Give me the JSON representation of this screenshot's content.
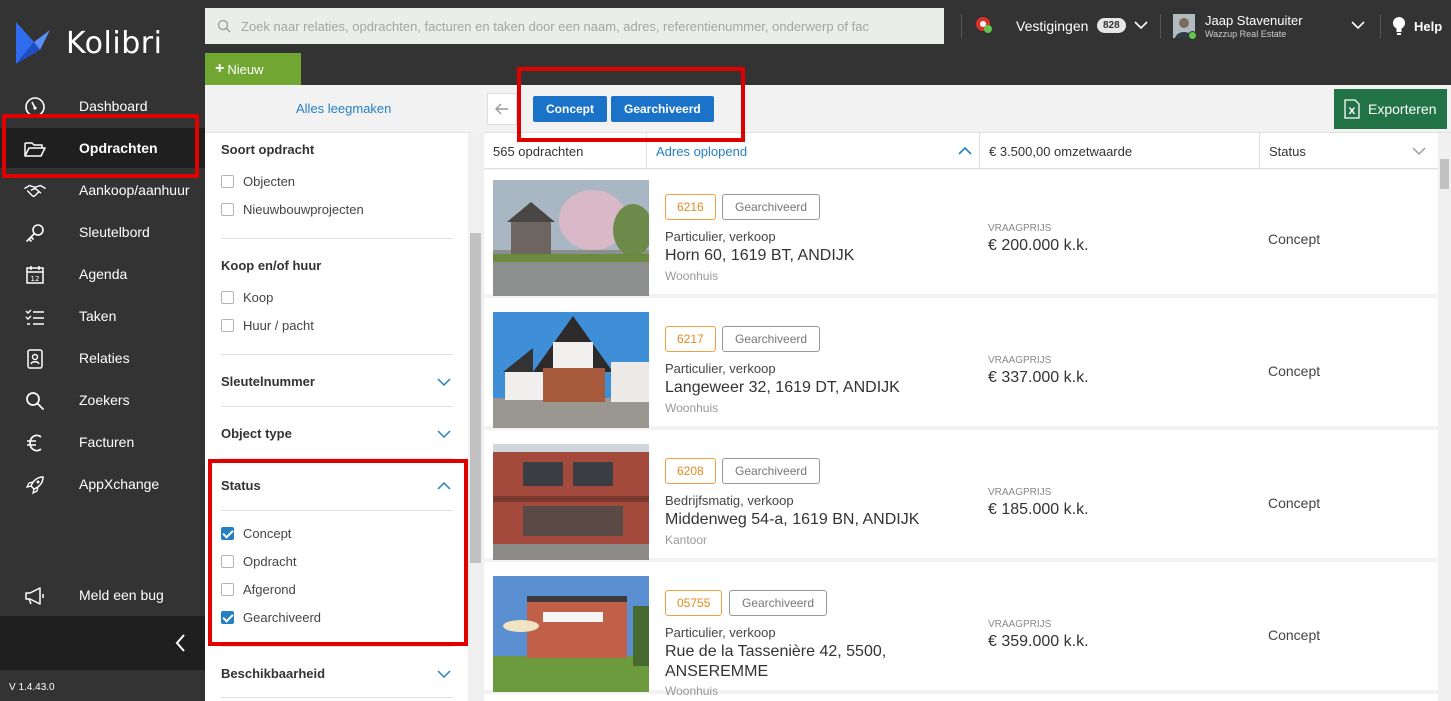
{
  "app": {
    "name": "Kolibri",
    "version": "V 1.4.43.0"
  },
  "search": {
    "placeholder": "Zoek naar relaties, opdrachten, facturen en taken door een naam, adres, referentienummer, onderwerp of fac"
  },
  "topbar": {
    "vestigingen_label": "Vestigingen",
    "vestigingen_count": "828",
    "user_name": "Jaap Stavenuiter",
    "user_company": "Wazzup Real Estate",
    "help_label": "Help",
    "new_button": "Nieuw"
  },
  "sidebar": {
    "items": [
      {
        "label": "Dashboard",
        "icon": "gauge-icon"
      },
      {
        "label": "Opdrachten",
        "icon": "folder-open-icon",
        "active": true
      },
      {
        "label": "Aankoop/aanhuur",
        "icon": "handshake-icon"
      },
      {
        "label": "Sleutelbord",
        "icon": "key-icon"
      },
      {
        "label": "Agenda",
        "icon": "calendar-icon"
      },
      {
        "label": "Taken",
        "icon": "tasks-icon"
      },
      {
        "label": "Relaties",
        "icon": "contact-icon"
      },
      {
        "label": "Zoekers",
        "icon": "search-icon"
      },
      {
        "label": "Facturen",
        "icon": "euro-icon"
      },
      {
        "label": "AppXchange",
        "icon": "rocket-icon"
      }
    ],
    "bug_label": "Meld een bug"
  },
  "filters": {
    "clear_all": "Alles leegmaken",
    "soort": {
      "title": "Soort opdracht",
      "options": [
        "Objecten",
        "Nieuwbouwprojecten"
      ]
    },
    "koop": {
      "title": "Koop en/of huur",
      "options": [
        "Koop",
        "Huur / pacht"
      ]
    },
    "sleutelnummer": {
      "title": "Sleutelnummer"
    },
    "objecttype": {
      "title": "Object type"
    },
    "status": {
      "title": "Status",
      "options": [
        {
          "label": "Concept",
          "checked": true
        },
        {
          "label": "Opdracht",
          "checked": false
        },
        {
          "label": "Afgerond",
          "checked": false
        },
        {
          "label": "Gearchiveerd",
          "checked": true
        }
      ]
    },
    "beschikbaarheid": {
      "title": "Beschikbaarheid"
    }
  },
  "toolbar": {
    "active_filters": [
      "Concept",
      "Gearchiveerd"
    ],
    "export_label": "Exporteren"
  },
  "columns": {
    "count": "565 opdrachten",
    "address": "Adres oplopend",
    "value": "€ 3.500,00 omzetwaarde",
    "status": "Status"
  },
  "rows": [
    {
      "code": "6216",
      "badge": "Gearchiveerd",
      "type": "Particulier, verkoop",
      "address": "Horn 60, 1619 BT, ANDIJK",
      "kind": "Woonhuis",
      "price_label": "VRAAGPRIJS",
      "price": "€ 200.000 k.k.",
      "status": "Concept"
    },
    {
      "code": "6217",
      "badge": "Gearchiveerd",
      "type": "Particulier, verkoop",
      "address": "Langeweer 32, 1619 DT, ANDIJK",
      "kind": "Woonhuis",
      "price_label": "VRAAGPRIJS",
      "price": "€ 337.000 k.k.",
      "status": "Concept"
    },
    {
      "code": "6208",
      "badge": "Gearchiveerd",
      "type": "Bedrijfsmatig, verkoop",
      "address": "Middenweg 54-a, 1619 BN, ANDIJK",
      "kind": "Kantoor",
      "price_label": "VRAAGPRIJS",
      "price": "€ 185.000 k.k.",
      "status": "Concept"
    },
    {
      "code": "05755",
      "badge": "Gearchiveerd",
      "type": "Particulier, verkoop",
      "address": "Rue de la Tassenière 42, 5500, ANSEREMME",
      "kind": "Woonhuis",
      "price_label": "VRAAGPRIJS",
      "price": "€ 359.000 k.k.",
      "status": "Concept"
    }
  ],
  "colors": {
    "sidebar": "#333333",
    "accent_blue": "#1a73c9",
    "new_green": "#70a631",
    "excel_green": "#217346",
    "code_orange": "#e08a1e",
    "annotation_red": "#e00000"
  }
}
